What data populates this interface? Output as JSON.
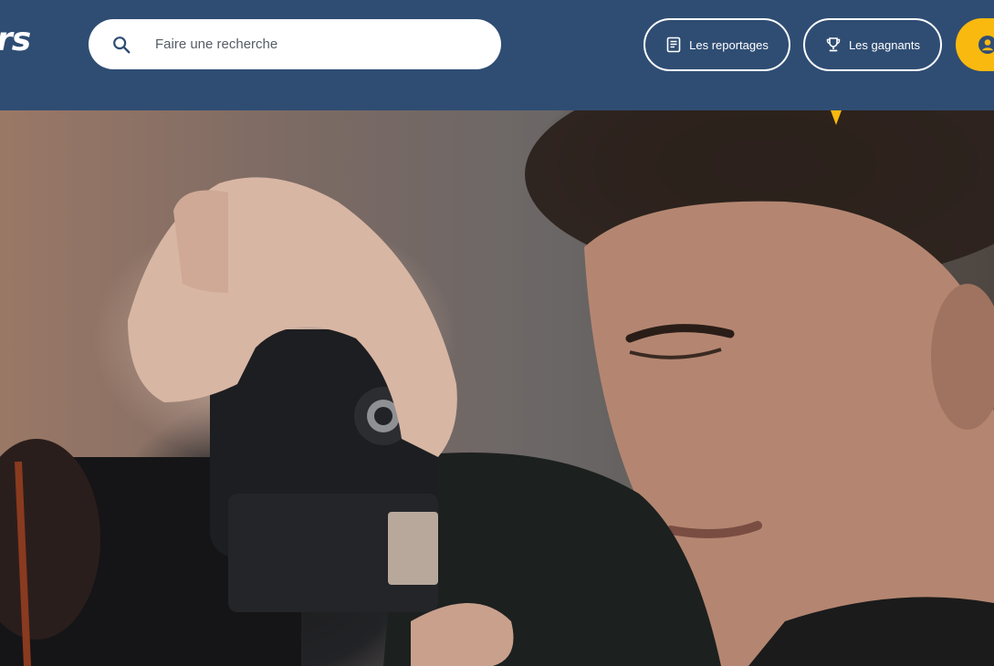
{
  "header": {
    "logo_text": "rs",
    "search": {
      "placeholder": "Faire une recherche",
      "value": ""
    },
    "nav": {
      "reportages": {
        "label": "Les reportages",
        "icon": "book-icon"
      },
      "gagnants": {
        "label": "Les gagnants",
        "icon": "trophy-icon"
      }
    },
    "account": {
      "icon": "user-avatar-icon"
    }
  },
  "hero": {
    "image": "photographer-with-camera",
    "marker_color": "#f9b90f"
  },
  "colors": {
    "header_background": "#2f4d73",
    "accent": "#f9b90f",
    "search_background": "#ffffff"
  }
}
